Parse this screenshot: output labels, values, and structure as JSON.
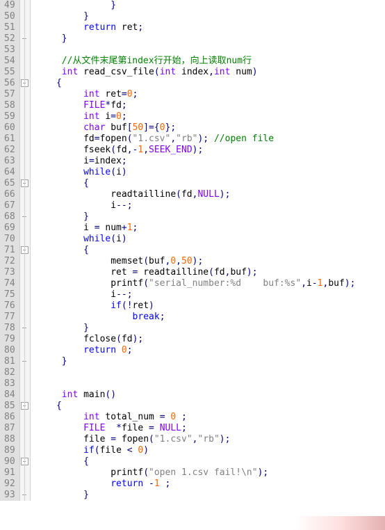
{
  "lines": [
    {
      "n": 49,
      "fold": "",
      "code": [
        [
          "punc",
          "              }"
        ]
      ]
    },
    {
      "n": 50,
      "fold": "",
      "code": [
        [
          "punc",
          "         }"
        ]
      ]
    },
    {
      "n": 51,
      "fold": "",
      "code": [
        [
          "norm",
          "         "
        ],
        [
          "kw",
          "return"
        ],
        [
          "norm",
          " ret"
        ],
        [
          "punc",
          ";"
        ]
      ]
    },
    {
      "n": 52,
      "fold": "close",
      "code": [
        [
          "punc",
          "     }"
        ]
      ]
    },
    {
      "n": 53,
      "fold": "",
      "code": [
        [
          "norm",
          ""
        ]
      ]
    },
    {
      "n": 54,
      "fold": "",
      "code": [
        [
          "norm",
          "     "
        ],
        [
          "cmt",
          "//从文件末尾第index行开始，向上读取num行"
        ]
      ]
    },
    {
      "n": 55,
      "fold": "",
      "code": [
        [
          "norm",
          "     "
        ],
        [
          "type",
          "int"
        ],
        [
          "norm",
          " "
        ],
        [
          "func",
          "read_csv_file"
        ],
        [
          "punc",
          "("
        ],
        [
          "type",
          "int"
        ],
        [
          "norm",
          " index"
        ],
        [
          "punc",
          ","
        ],
        [
          "type",
          "int"
        ],
        [
          "norm",
          " num"
        ],
        [
          "punc",
          ")"
        ]
      ]
    },
    {
      "n": 56,
      "fold": "open",
      "code": [
        [
          "punc",
          "    {"
        ]
      ]
    },
    {
      "n": 57,
      "fold": "",
      "code": [
        [
          "norm",
          "         "
        ],
        [
          "type",
          "int"
        ],
        [
          "norm",
          " ret"
        ],
        [
          "op",
          "="
        ],
        [
          "num",
          "0"
        ],
        [
          "punc",
          ";"
        ]
      ]
    },
    {
      "n": 58,
      "fold": "",
      "code": [
        [
          "norm",
          "         "
        ],
        [
          "type",
          "FILE"
        ],
        [
          "op",
          "*"
        ],
        [
          "norm",
          "fd"
        ],
        [
          "punc",
          ";"
        ]
      ]
    },
    {
      "n": 59,
      "fold": "",
      "code": [
        [
          "norm",
          "         "
        ],
        [
          "type",
          "int"
        ],
        [
          "norm",
          " i"
        ],
        [
          "op",
          "="
        ],
        [
          "num",
          "0"
        ],
        [
          "punc",
          ";"
        ]
      ]
    },
    {
      "n": 60,
      "fold": "",
      "code": [
        [
          "norm",
          "         "
        ],
        [
          "type",
          "char"
        ],
        [
          "norm",
          " buf"
        ],
        [
          "punc",
          "["
        ],
        [
          "num",
          "50"
        ],
        [
          "punc",
          "]"
        ],
        [
          "op",
          "="
        ],
        [
          "punc",
          "{"
        ],
        [
          "num",
          "0"
        ],
        [
          "punc",
          "};"
        ]
      ]
    },
    {
      "n": 61,
      "fold": "",
      "code": [
        [
          "norm",
          "         fd"
        ],
        [
          "op",
          "="
        ],
        [
          "func",
          "fopen"
        ],
        [
          "punc",
          "("
        ],
        [
          "str",
          "\"1.csv\""
        ],
        [
          "punc",
          ","
        ],
        [
          "str",
          "\"rb\""
        ],
        [
          "punc",
          ");"
        ],
        [
          "norm",
          " "
        ],
        [
          "cmt",
          "//open file"
        ]
      ]
    },
    {
      "n": 62,
      "fold": "",
      "code": [
        [
          "norm",
          "         "
        ],
        [
          "func",
          "fseek"
        ],
        [
          "punc",
          "("
        ],
        [
          "norm",
          "fd"
        ],
        [
          "punc",
          ","
        ],
        [
          "op",
          "-"
        ],
        [
          "num",
          "1"
        ],
        [
          "punc",
          ","
        ],
        [
          "macro",
          "SEEK_END"
        ],
        [
          "punc",
          ");"
        ]
      ]
    },
    {
      "n": 63,
      "fold": "",
      "code": [
        [
          "norm",
          "         i"
        ],
        [
          "op",
          "="
        ],
        [
          "norm",
          "index"
        ],
        [
          "punc",
          ";"
        ]
      ]
    },
    {
      "n": 64,
      "fold": "",
      "code": [
        [
          "norm",
          "         "
        ],
        [
          "kw",
          "while"
        ],
        [
          "punc",
          "("
        ],
        [
          "norm",
          "i"
        ],
        [
          "punc",
          ")"
        ]
      ]
    },
    {
      "n": 65,
      "fold": "open",
      "code": [
        [
          "norm",
          "         "
        ],
        [
          "punc",
          "{"
        ]
      ]
    },
    {
      "n": 66,
      "fold": "",
      "code": [
        [
          "norm",
          "              "
        ],
        [
          "func",
          "readtailline"
        ],
        [
          "punc",
          "("
        ],
        [
          "norm",
          "fd"
        ],
        [
          "punc",
          ","
        ],
        [
          "macro",
          "NULL"
        ],
        [
          "punc",
          ");"
        ]
      ]
    },
    {
      "n": 67,
      "fold": "",
      "code": [
        [
          "norm",
          "              i"
        ],
        [
          "op",
          "--"
        ],
        [
          "punc",
          ";"
        ]
      ]
    },
    {
      "n": 68,
      "fold": "close",
      "code": [
        [
          "norm",
          "         "
        ],
        [
          "punc",
          "}"
        ]
      ]
    },
    {
      "n": 69,
      "fold": "",
      "code": [
        [
          "norm",
          "         i "
        ],
        [
          "op",
          "="
        ],
        [
          "norm",
          " num"
        ],
        [
          "op",
          "+"
        ],
        [
          "num",
          "1"
        ],
        [
          "punc",
          ";"
        ]
      ]
    },
    {
      "n": 70,
      "fold": "",
      "code": [
        [
          "norm",
          "         "
        ],
        [
          "kw",
          "while"
        ],
        [
          "punc",
          "("
        ],
        [
          "norm",
          "i"
        ],
        [
          "punc",
          ")"
        ]
      ]
    },
    {
      "n": 71,
      "fold": "open",
      "code": [
        [
          "norm",
          "         "
        ],
        [
          "punc",
          "{"
        ]
      ]
    },
    {
      "n": 72,
      "fold": "",
      "code": [
        [
          "norm",
          "              "
        ],
        [
          "func",
          "memset"
        ],
        [
          "punc",
          "("
        ],
        [
          "norm",
          "buf"
        ],
        [
          "punc",
          ","
        ],
        [
          "num",
          "0"
        ],
        [
          "punc",
          ","
        ],
        [
          "num",
          "50"
        ],
        [
          "punc",
          ");"
        ]
      ]
    },
    {
      "n": 73,
      "fold": "",
      "code": [
        [
          "norm",
          "              ret "
        ],
        [
          "op",
          "="
        ],
        [
          "norm",
          " "
        ],
        [
          "func",
          "readtailline"
        ],
        [
          "punc",
          "("
        ],
        [
          "norm",
          "fd"
        ],
        [
          "punc",
          ","
        ],
        [
          "norm",
          "buf"
        ],
        [
          "punc",
          ");"
        ]
      ]
    },
    {
      "n": 74,
      "fold": "",
      "code": [
        [
          "norm",
          "              "
        ],
        [
          "func",
          "printf"
        ],
        [
          "punc",
          "("
        ],
        [
          "str",
          "\"serial_number:%d    buf:%s\""
        ],
        [
          "punc",
          ","
        ],
        [
          "norm",
          "i"
        ],
        [
          "op",
          "-"
        ],
        [
          "num",
          "1"
        ],
        [
          "punc",
          ","
        ],
        [
          "norm",
          "buf"
        ],
        [
          "punc",
          ");"
        ]
      ]
    },
    {
      "n": 75,
      "fold": "",
      "code": [
        [
          "norm",
          "              i"
        ],
        [
          "op",
          "--"
        ],
        [
          "punc",
          ";"
        ]
      ]
    },
    {
      "n": 76,
      "fold": "",
      "code": [
        [
          "norm",
          "              "
        ],
        [
          "kw",
          "if"
        ],
        [
          "punc",
          "("
        ],
        [
          "op",
          "!"
        ],
        [
          "norm",
          "ret"
        ],
        [
          "punc",
          ")"
        ]
      ]
    },
    {
      "n": 77,
      "fold": "",
      "code": [
        [
          "norm",
          "                  "
        ],
        [
          "kw",
          "break"
        ],
        [
          "punc",
          ";"
        ]
      ]
    },
    {
      "n": 78,
      "fold": "close",
      "code": [
        [
          "norm",
          "         "
        ],
        [
          "punc",
          "}"
        ]
      ]
    },
    {
      "n": 79,
      "fold": "",
      "code": [
        [
          "norm",
          "         "
        ],
        [
          "func",
          "fclose"
        ],
        [
          "punc",
          "("
        ],
        [
          "norm",
          "fd"
        ],
        [
          "punc",
          ");"
        ]
      ]
    },
    {
      "n": 80,
      "fold": "",
      "code": [
        [
          "norm",
          "         "
        ],
        [
          "kw",
          "return"
        ],
        [
          "norm",
          " "
        ],
        [
          "num",
          "0"
        ],
        [
          "punc",
          ";"
        ]
      ]
    },
    {
      "n": 81,
      "fold": "close",
      "code": [
        [
          "norm",
          "     "
        ],
        [
          "punc",
          "}"
        ]
      ]
    },
    {
      "n": 82,
      "fold": "",
      "code": [
        [
          "norm",
          ""
        ]
      ]
    },
    {
      "n": 83,
      "fold": "",
      "code": [
        [
          "norm",
          ""
        ]
      ]
    },
    {
      "n": 84,
      "fold": "",
      "code": [
        [
          "norm",
          "     "
        ],
        [
          "type",
          "int"
        ],
        [
          "norm",
          " "
        ],
        [
          "func",
          "main"
        ],
        [
          "punc",
          "()"
        ]
      ]
    },
    {
      "n": 85,
      "fold": "open",
      "code": [
        [
          "norm",
          "    "
        ],
        [
          "punc",
          "{"
        ]
      ]
    },
    {
      "n": 86,
      "fold": "",
      "code": [
        [
          "norm",
          "         "
        ],
        [
          "type",
          "int"
        ],
        [
          "norm",
          " total_num "
        ],
        [
          "op",
          "="
        ],
        [
          "norm",
          " "
        ],
        [
          "num",
          "0"
        ],
        [
          "norm",
          " "
        ],
        [
          "punc",
          ";"
        ]
      ]
    },
    {
      "n": 87,
      "fold": "",
      "code": [
        [
          "norm",
          "         "
        ],
        [
          "type",
          "FILE"
        ],
        [
          "norm",
          "  "
        ],
        [
          "op",
          "*"
        ],
        [
          "norm",
          "file "
        ],
        [
          "op",
          "="
        ],
        [
          "norm",
          " "
        ],
        [
          "macro",
          "NULL"
        ],
        [
          "punc",
          ";"
        ]
      ]
    },
    {
      "n": 88,
      "fold": "",
      "code": [
        [
          "norm",
          "         file "
        ],
        [
          "op",
          "="
        ],
        [
          "norm",
          " "
        ],
        [
          "func",
          "fopen"
        ],
        [
          "punc",
          "("
        ],
        [
          "str",
          "\"1.csv\""
        ],
        [
          "punc",
          ","
        ],
        [
          "str",
          "\"rb\""
        ],
        [
          "punc",
          ");"
        ]
      ]
    },
    {
      "n": 89,
      "fold": "",
      "code": [
        [
          "norm",
          "         "
        ],
        [
          "kw",
          "if"
        ],
        [
          "punc",
          "("
        ],
        [
          "norm",
          "file "
        ],
        [
          "op",
          "<"
        ],
        [
          "norm",
          " "
        ],
        [
          "num",
          "0"
        ],
        [
          "punc",
          ")"
        ]
      ]
    },
    {
      "n": 90,
      "fold": "open",
      "code": [
        [
          "norm",
          "         "
        ],
        [
          "punc",
          "{"
        ]
      ]
    },
    {
      "n": 91,
      "fold": "",
      "code": [
        [
          "norm",
          "              "
        ],
        [
          "func",
          "printf"
        ],
        [
          "punc",
          "("
        ],
        [
          "str",
          "\"open 1.csv fail!\\n\""
        ],
        [
          "punc",
          ");"
        ]
      ]
    },
    {
      "n": 92,
      "fold": "",
      "code": [
        [
          "norm",
          "              "
        ],
        [
          "kw",
          "return"
        ],
        [
          "norm",
          " "
        ],
        [
          "op",
          "-"
        ],
        [
          "num",
          "1"
        ],
        [
          "norm",
          " "
        ],
        [
          "punc",
          ";"
        ]
      ]
    },
    {
      "n": 93,
      "fold": "close",
      "code": [
        [
          "norm",
          "         "
        ],
        [
          "punc",
          "}"
        ]
      ]
    }
  ]
}
